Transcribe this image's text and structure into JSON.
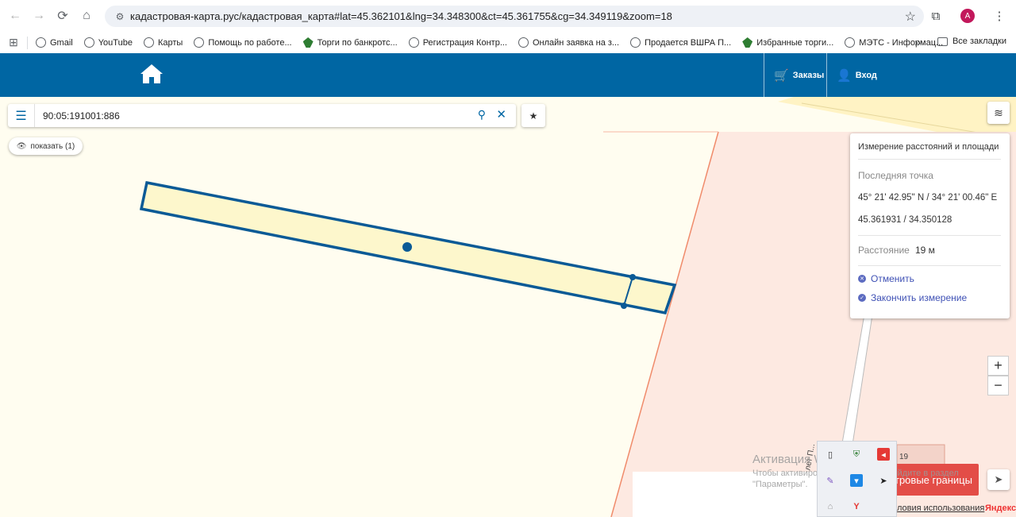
{
  "browser": {
    "url": "кадастровая-карта.рус/кадастровая_карта#lat=45.362101&lng=34.348300&ct=45.361755&cg=34.349119&zoom=18",
    "avatar_letter": "A",
    "bookmarks": [
      {
        "label": "Gmail",
        "icon": "globe-icon"
      },
      {
        "label": "YouTube",
        "icon": "globe-icon"
      },
      {
        "label": "Карты",
        "icon": "globe-icon"
      },
      {
        "label": "Помощь по работе...",
        "icon": "globe-icon"
      },
      {
        "label": "Торги по банкротс...",
        "icon": "hammer-icon"
      },
      {
        "label": "Регистрация Контр...",
        "icon": "globe-icon"
      },
      {
        "label": "Онлайн заявка на з...",
        "icon": "globe-icon"
      },
      {
        "label": "Продается ВШРА П...",
        "icon": "globe-icon"
      },
      {
        "label": "Избранные торги...",
        "icon": "hammer-icon"
      },
      {
        "label": "МЭТС - Информац...",
        "icon": "globe-icon"
      }
    ],
    "more": "»",
    "all_bookmarks": "Все закладки"
  },
  "header": {
    "orders_label": "Заказы",
    "login_label": "Вход",
    "color": "#0066a3"
  },
  "search": {
    "value": "90:05:191001:886"
  },
  "show_button": "показать (1)",
  "measure": {
    "title": "Измерение расстояний и площади",
    "last_point_label": "Последняя точка",
    "coord_dms": "45° 21' 42.95\" N / 34° 21' 00.46\" E",
    "coord_dec": "45.361931 / 34.350128",
    "distance_label": "Расстояние",
    "distance_value": "19 м",
    "cancel_label": "Отменить",
    "finish_label": "Закончить измерение"
  },
  "zoom": {
    "in": "+",
    "out": "−"
  },
  "red_button": "тровые границы",
  "watermark": {
    "line1": "Активация Windows",
    "line2": "Чтобы активировать Windows, перейдите в раздел",
    "line3": "\"Параметры\"."
  },
  "map_labels": {
    "terms": "ловия использования",
    "yandex": "Яндекс",
    "house_number": "19",
    "street": "40 лет П..."
  },
  "colors": {
    "parcel_fill": "#fdf7cc",
    "parcel_stroke": "#0a5a96",
    "zone_fill": "#fde9e1",
    "zone_stroke": "#f08b6b",
    "road": "#fff0b8"
  }
}
